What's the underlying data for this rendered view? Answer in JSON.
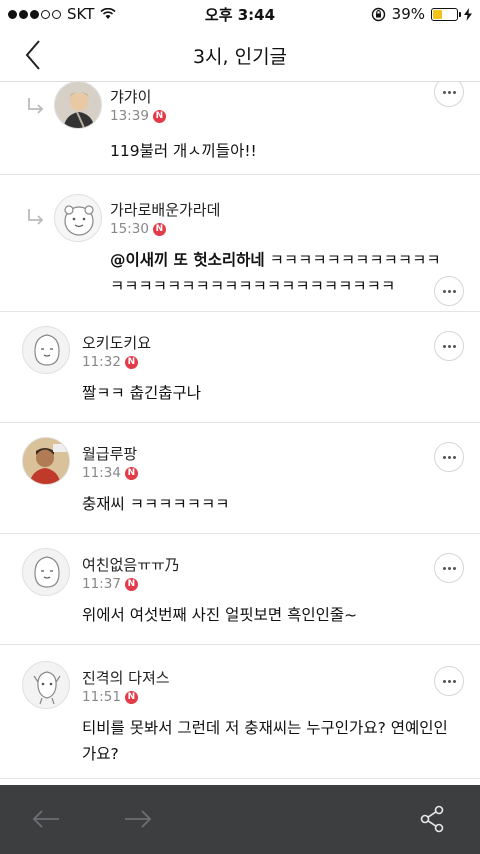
{
  "status": {
    "carrier": "SKT",
    "time": "오후 3:44",
    "battery": "39%",
    "battery_level": 0.39
  },
  "header": {
    "title": "3시, 인기글"
  },
  "comments": [
    {
      "nickname": "갸갸이",
      "time": "13:39",
      "badge": "N",
      "text": "119불러 개ㅅ끼들아!!",
      "reply": true,
      "more": "more"
    },
    {
      "nickname": "가라로배운가라데",
      "time": "15:30",
      "badge": "N",
      "mention": "@이새끼 또 헛소리하네",
      "text": " ㅋㅋㅋㅋㅋㅋㅋㅋㅋㅋㅋㅋㅋㅋㅋㅋㅋㅋㅋㅋㅋㅋㅋㅋㅋㅋㅋㅋㅋㅋㅋㅋ",
      "reply": true
    },
    {
      "nickname": "오키도키요",
      "time": "11:32",
      "badge": "N",
      "text": "짤ㅋㅋ 춥긴춥구나"
    },
    {
      "nickname": "월급루팡",
      "time": "11:34",
      "badge": "N",
      "text": "충재씨 ㅋㅋㅋㅋㅋㅋㅋ"
    },
    {
      "nickname": "여친없음ㅠㅠ乃",
      "time": "11:37",
      "badge": "N",
      "text": "위에서 여섯번째 사진 얼핏보면 흑인인줄~"
    },
    {
      "nickname": "진격의 다져스",
      "time": "11:51",
      "badge": "N",
      "text": "티비를 못봐서 그런데 저 충재씨는 누구인가요? 연예인인가요?"
    }
  ]
}
